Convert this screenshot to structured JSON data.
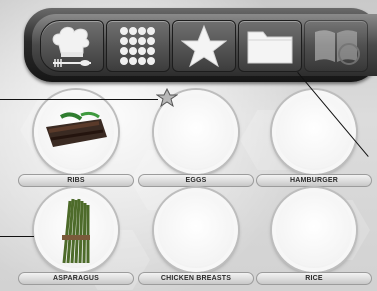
{
  "toolbar": {
    "buttons": [
      {
        "name": "recipes-tab",
        "icon": "chef-hat-icon"
      },
      {
        "name": "keypad-tab",
        "icon": "keypad-icon"
      },
      {
        "name": "favorites-tab",
        "icon": "star-icon"
      },
      {
        "name": "folder-tab",
        "icon": "folder-icon"
      },
      {
        "name": "cookbook-tab",
        "icon": "cookbook-icon"
      }
    ]
  },
  "items": [
    {
      "label": "RIBS",
      "image": "ribs"
    },
    {
      "label": "EGGS",
      "image": "empty"
    },
    {
      "label": "HAMBURGER",
      "image": "empty"
    },
    {
      "label": "ASPARAGUS",
      "image": "asparagus"
    },
    {
      "label": "CHICKEN BREASTS",
      "image": "empty"
    },
    {
      "label": "RICE",
      "image": "empty"
    }
  ],
  "favorite_marker": {
    "icon": "small-star-icon"
  },
  "colors": {
    "accent": "#1a1a1a",
    "plate": "#ffffff",
    "background": "#d2d2d2"
  }
}
